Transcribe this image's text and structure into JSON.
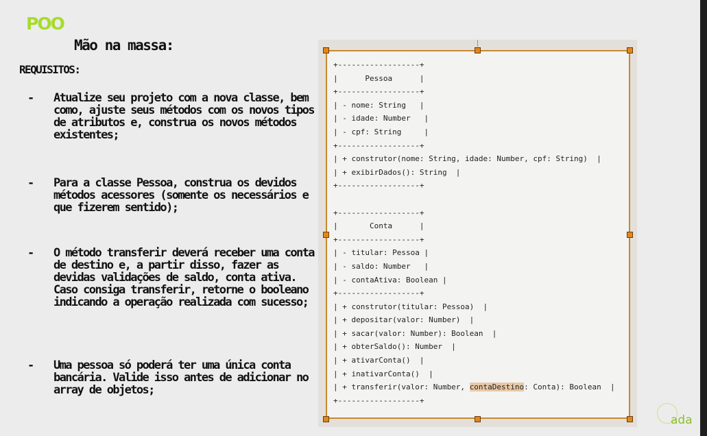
{
  "slide": {
    "title": "POO",
    "subtitle": "Mão na massa:",
    "requirements_heading": "REQUISITOS:",
    "bullets": [
      {
        "marker": "-",
        "text": "Atualize seu projeto com a nova classe, bem como, ajuste seus métodos com os novos tipos de atributos e, construa os novos métodos existentes;"
      },
      {
        "marker": "-",
        "text": "Para a classe Pessoa, construa os devidos métodos acessores (somente os necessários e que fizerem sentido);"
      },
      {
        "marker": "-",
        "text": "O método transferir deverá receber uma conta de destino e, a partir disso, fazer as devidas validações de saldo, conta ativa. Caso consiga transferir, retorne o booleano indicando a operação realizada com sucesso;"
      },
      {
        "marker": "-",
        "text": "Uma pessoa só poderá ter uma única conta bancária. Valide isso antes de adicionar no array de objetos;"
      }
    ],
    "logo_text": "ada"
  },
  "uml": {
    "lines": [
      "+------------------+",
      "|      Pessoa      |",
      "+------------------+",
      "| - nome: String   |",
      "| - idade: Number   |",
      "| - cpf: String     |",
      "+------------------+",
      "| + construtor(nome: String, idade: Number, cpf: String)  |",
      "| + exibirDados(): String  |",
      "+------------------+",
      "",
      "+------------------+",
      "|       Conta      |",
      "+------------------+",
      "| - titular: Pessoa |",
      "| - saldo: Number   |",
      "| - contaAtiva: Boolean |",
      "+------------------+",
      "| + construtor(titular: Pessoa)  |",
      "| + depositar(valor: Number)  |",
      "| + sacar(valor: Number): Boolean  |",
      "| + obterSaldo(): Number  |",
      "| + ativarConta()  |",
      "| + inativarConta()  |"
    ],
    "last_line_pre": "| + transferir(valor: Number, ",
    "last_line_highlight": "contaDestino",
    "last_line_post": ": Conta): Boolean  |",
    "closing_line": "+------------------+"
  }
}
